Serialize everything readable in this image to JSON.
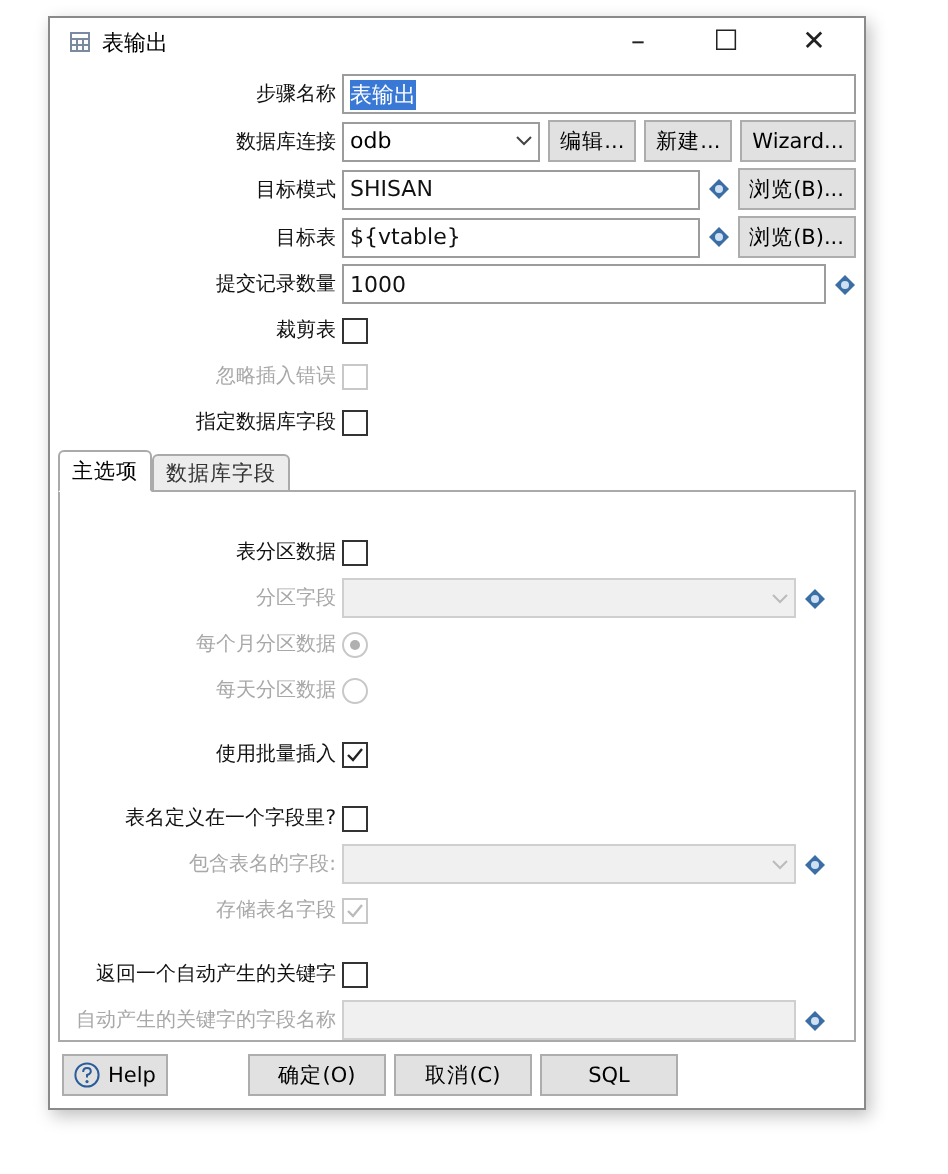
{
  "window": {
    "title": "表输出",
    "controls": [
      "–",
      "☐",
      "✕"
    ]
  },
  "fields": [
    {
      "kind": "text",
      "label": "步骤名称",
      "value": "表输出",
      "highlighted": true,
      "disabled": false
    },
    {
      "kind": "select",
      "label": "数据库连接",
      "value": "odb",
      "disabled": false,
      "buttons": [
        "编辑...",
        "新建...",
        "Wizard..."
      ]
    },
    {
      "kind": "text",
      "label": "目标模式",
      "value": "SHISAN",
      "variable": true,
      "disabled": false,
      "buttons": [
        "浏览(B)..."
      ]
    },
    {
      "kind": "text",
      "label": "目标表",
      "value": "${vtable}",
      "variable": true,
      "disabled": false,
      "buttons": [
        "浏览(B)..."
      ]
    },
    {
      "kind": "text",
      "label": "提交记录数量",
      "value": "1000",
      "variable": true,
      "disabled": false
    },
    {
      "kind": "checkbox",
      "label": "裁剪表",
      "checked": false,
      "disabled": false
    },
    {
      "kind": "checkbox",
      "label": "忽略插入错误",
      "checked": false,
      "disabled": true
    },
    {
      "kind": "checkbox",
      "label": "指定数据库字段",
      "checked": false,
      "disabled": false
    }
  ],
  "tabs": [
    {
      "label": "主选项",
      "selected": true
    },
    {
      "label": "数据库字段",
      "selected": false
    }
  ],
  "panel": {
    "sections": [
      [
        {
          "kind": "checkbox",
          "label": "表分区数据",
          "checked": false,
          "disabled": false
        },
        {
          "kind": "select",
          "label": "分区字段",
          "variable": true,
          "disabled": true
        },
        {
          "kind": "radio",
          "label": "每个月分区数据",
          "selected": true,
          "disabled": true
        },
        {
          "kind": "radio",
          "label": "每天分区数据",
          "selected": false,
          "disabled": true
        }
      ],
      [
        {
          "kind": "checkbox",
          "label": "使用批量插入",
          "checked": true,
          "disabled": false
        }
      ],
      [
        {
          "kind": "checkbox",
          "label": "表名定义在一个字段里?",
          "checked": false,
          "disabled": false
        },
        {
          "kind": "select",
          "label": "包含表名的字段:",
          "variable": true,
          "disabled": true
        },
        {
          "kind": "checkbox",
          "label": "存储表名字段",
          "checked": true,
          "disabled": true
        }
      ],
      [
        {
          "kind": "checkbox",
          "label": "返回一个自动产生的关键字",
          "checked": false,
          "disabled": false
        },
        {
          "kind": "text",
          "label": "自动产生的关键字的字段名称",
          "variable": true,
          "disabled": true
        }
      ]
    ]
  },
  "help": "Help",
  "buttons": [
    "确定(O)",
    "取消(C)",
    "SQL"
  ]
}
